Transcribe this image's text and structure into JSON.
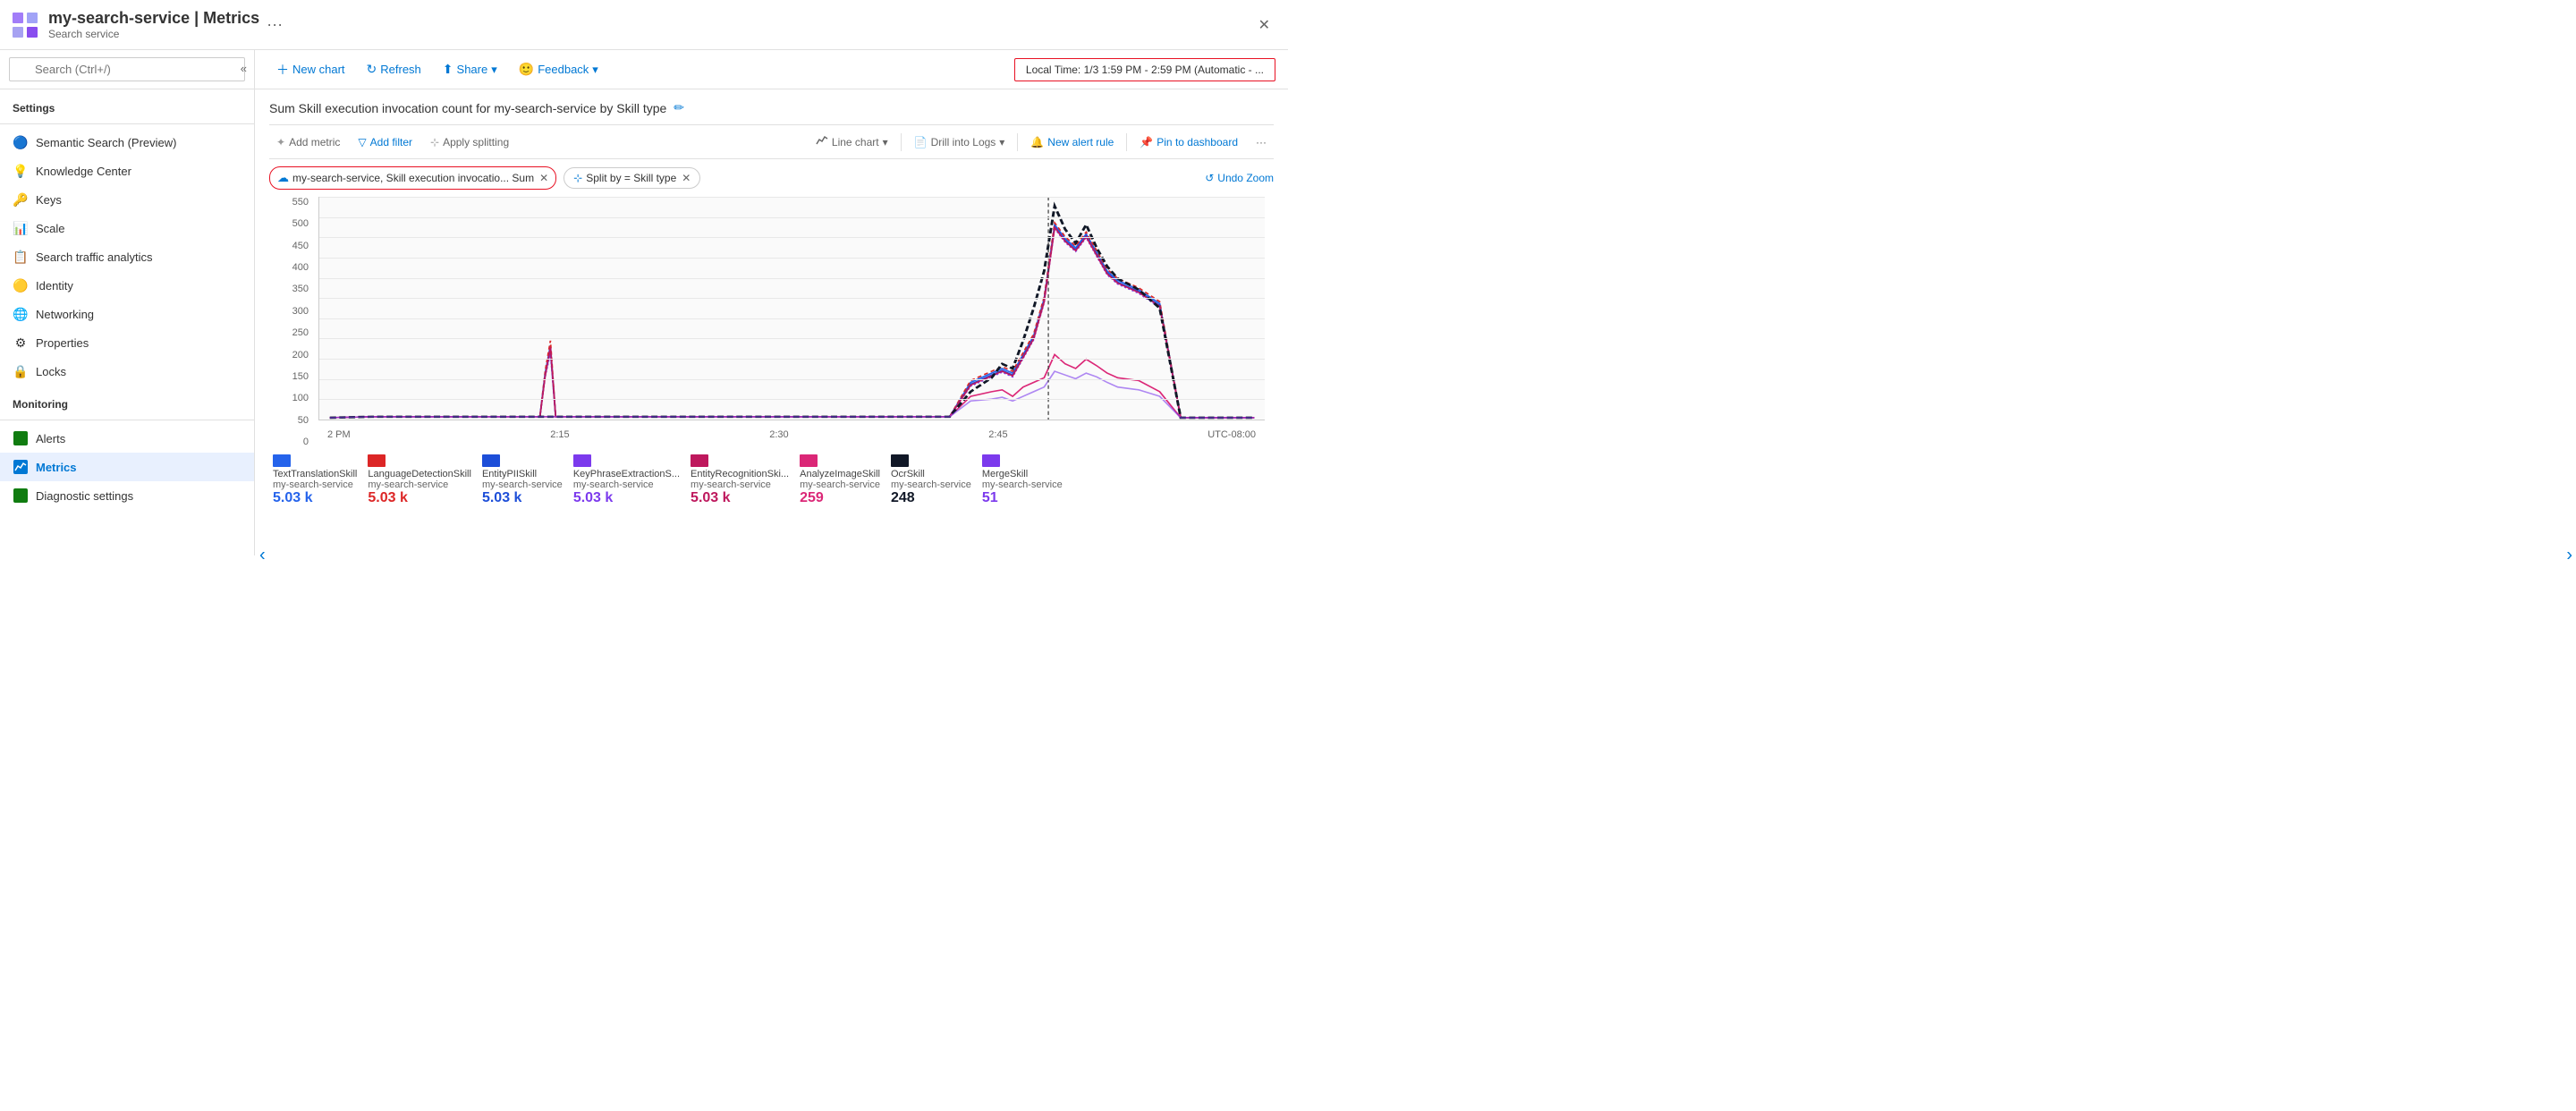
{
  "app": {
    "title": "my-search-service | Metrics",
    "subtitle": "Search service",
    "dots_label": "···",
    "close_label": "✕"
  },
  "sidebar": {
    "search_placeholder": "Search (Ctrl+/)",
    "sections": [
      {
        "label": "Settings",
        "items": [
          {
            "id": "semantic-search",
            "label": "Semantic Search (Preview)",
            "icon": "🔵"
          },
          {
            "id": "knowledge-center",
            "label": "Knowledge Center",
            "icon": "💡"
          },
          {
            "id": "keys",
            "label": "Keys",
            "icon": "🔑"
          },
          {
            "id": "scale",
            "label": "Scale",
            "icon": "📊"
          },
          {
            "id": "search-traffic",
            "label": "Search traffic analytics",
            "icon": "📋"
          },
          {
            "id": "identity",
            "label": "Identity",
            "icon": "🟡"
          },
          {
            "id": "networking",
            "label": "Networking",
            "icon": "🌐"
          },
          {
            "id": "properties",
            "label": "Properties",
            "icon": "⚙"
          },
          {
            "id": "locks",
            "label": "Locks",
            "icon": "🔒"
          }
        ]
      },
      {
        "label": "Monitoring",
        "items": [
          {
            "id": "alerts",
            "label": "Alerts",
            "icon": "🟩"
          },
          {
            "id": "metrics",
            "label": "Metrics",
            "icon": "📈",
            "active": true
          },
          {
            "id": "diagnostic-settings",
            "label": "Diagnostic settings",
            "icon": "🟩"
          }
        ]
      }
    ]
  },
  "toolbar": {
    "new_chart": "New chart",
    "refresh": "Refresh",
    "share": "Share",
    "feedback": "Feedback",
    "time_range": "Local Time: 1/3 1:59 PM - 2:59 PM (Automatic - ..."
  },
  "chart": {
    "title": "Sum Skill execution invocation count for my-search-service by Skill type",
    "add_metric": "Add metric",
    "add_filter": "Add filter",
    "apply_splitting": "Apply splitting",
    "line_chart": "Line chart",
    "drill_into_logs": "Drill into Logs",
    "new_alert_rule": "New alert rule",
    "pin_to_dashboard": "Pin to dashboard",
    "more": "···",
    "undo_zoom": "Undo Zoom",
    "metric_pill_label": "my-search-service, Skill execution invocatio... Sum",
    "split_pill_label": "Split by = Skill type",
    "y_axis": [
      "550",
      "500",
      "450",
      "400",
      "350",
      "300",
      "250",
      "200",
      "150",
      "100",
      "50",
      "0"
    ],
    "x_axis": [
      "2 PM",
      "2:15",
      "2:30",
      "2:45",
      "UTC-08:00"
    ]
  },
  "legend": [
    {
      "id": "text-translation",
      "name": "TextTranslationSkill",
      "sub": "my-search-service",
      "value": "5.03 k",
      "color": "#2563EB"
    },
    {
      "id": "language-detection",
      "name": "LanguageDetectionSkill",
      "sub": "my-search-service",
      "value": "5.03 k",
      "color": "#DC2626"
    },
    {
      "id": "entity-pii",
      "name": "EntityPIISkill",
      "sub": "my-search-service",
      "value": "5.03 k",
      "color": "#1D4ED8"
    },
    {
      "id": "key-phrase",
      "name": "KeyPhraseExtractionS...",
      "sub": "my-search-service",
      "value": "5.03 k",
      "color": "#7C3AED"
    },
    {
      "id": "entity-recognition",
      "name": "EntityRecognitionSki...",
      "sub": "my-search-service",
      "value": "5.03 k",
      "color": "#BE185D"
    },
    {
      "id": "analyze-image",
      "name": "AnalyzeImageSkill",
      "sub": "my-search-service",
      "value": "259",
      "color": "#DB2777"
    },
    {
      "id": "ocr-skill",
      "name": "OcrSkill",
      "sub": "my-search-service",
      "value": "248",
      "color": "#111827"
    },
    {
      "id": "merge-skill",
      "name": "MergeSkill",
      "sub": "my-search-service",
      "value": "51",
      "color": "#7C3AED"
    }
  ]
}
